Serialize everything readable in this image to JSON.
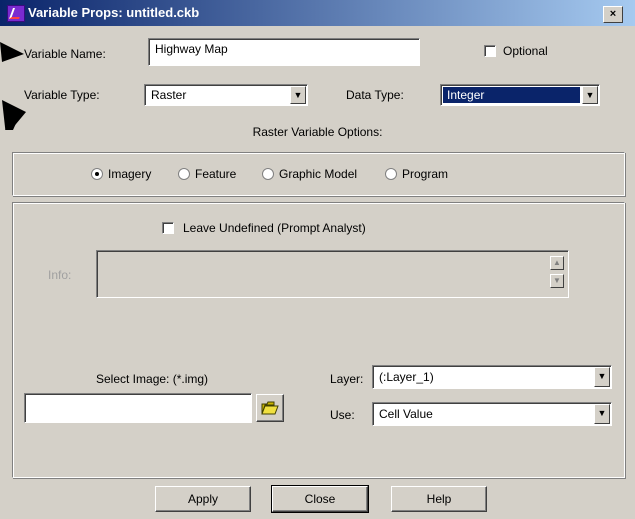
{
  "window": {
    "title": "Variable Props: untitled.ckb",
    "close_glyph": "×"
  },
  "variable_name": {
    "label": "Variable Name:",
    "value": "Highway Map"
  },
  "optional": {
    "label": "Optional",
    "checked": false
  },
  "variable_type": {
    "label": "Variable Type:",
    "value": "Raster"
  },
  "data_type": {
    "label": "Data Type:",
    "value": "Integer"
  },
  "raster_options": {
    "heading": "Raster Variable Options:",
    "radios": [
      {
        "label": "Imagery",
        "checked": true
      },
      {
        "label": "Feature",
        "checked": false
      },
      {
        "label": "Graphic Model",
        "checked": false
      },
      {
        "label": "Program",
        "checked": false
      }
    ]
  },
  "leave_undefined": {
    "label": "Leave Undefined (Prompt Analyst)",
    "checked": false
  },
  "info": {
    "label": "Info:",
    "value": ""
  },
  "select_image": {
    "label": "Select Image: (*.img)",
    "value": ""
  },
  "layer": {
    "label": "Layer:",
    "value": "(:Layer_1)"
  },
  "use": {
    "label": "Use:",
    "value": "Cell Value"
  },
  "buttons": {
    "apply": "Apply",
    "close": "Close",
    "help": "Help"
  },
  "glyphs": {
    "combo_arrow": "▼",
    "scroll_up": "▲",
    "scroll_down": "▼"
  },
  "colors": {
    "title_start": "#0a246a",
    "title_end": "#a6caf0",
    "selection": "#0a246a",
    "face": "#d4d0c8"
  },
  "icons": {
    "browse": "folder-open-icon"
  }
}
